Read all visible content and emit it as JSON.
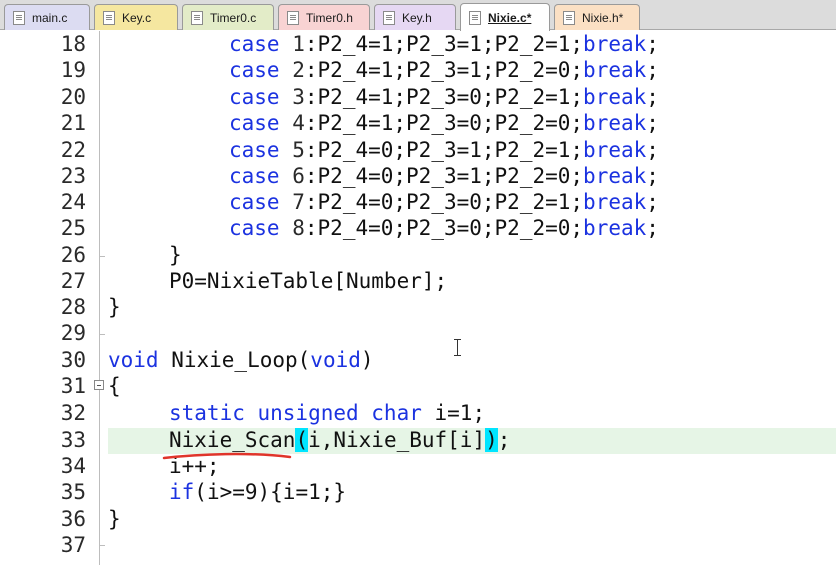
{
  "tabs": [
    {
      "label": "main.c",
      "color": "#dcdcf2"
    },
    {
      "label": "Key.c",
      "color": "#f5e7a0"
    },
    {
      "label": "Timer0.c",
      "color": "#e3ecc8"
    },
    {
      "label": "Timer0.h",
      "color": "#f8d3d3"
    },
    {
      "label": "Key.h",
      "color": "#e6d8f3"
    },
    {
      "label": "Nixie.c*",
      "color": "#ffffff",
      "active": true
    },
    {
      "label": "Nixie.h*",
      "color": "#fbe0c4"
    }
  ],
  "line_numbers": [
    "18",
    "19",
    "20",
    "21",
    "22",
    "23",
    "24",
    "25",
    "26",
    "27",
    "28",
    "29",
    "30",
    "31",
    "32",
    "33",
    "34",
    "35",
    "36",
    "37"
  ],
  "code": {
    "l18": {
      "kw": "case",
      "n": "1",
      "rest": ":P2_4=1;P2_3=1;P2_2=1;",
      "brk": "break",
      "end": ";"
    },
    "l19": {
      "kw": "case",
      "n": "2",
      "rest": ":P2_4=1;P2_3=1;P2_2=0;",
      "brk": "break",
      "end": ";"
    },
    "l20": {
      "kw": "case",
      "n": "3",
      "rest": ":P2_4=1;P2_3=0;P2_2=1;",
      "brk": "break",
      "end": ";"
    },
    "l21": {
      "kw": "case",
      "n": "4",
      "rest": ":P2_4=1;P2_3=0;P2_2=0;",
      "brk": "break",
      "end": ";"
    },
    "l22": {
      "kw": "case",
      "n": "5",
      "rest": ":P2_4=0;P2_3=1;P2_2=1;",
      "brk": "break",
      "end": ";"
    },
    "l23": {
      "kw": "case",
      "n": "6",
      "rest": ":P2_4=0;P2_3=1;P2_2=0;",
      "brk": "break",
      "end": ";"
    },
    "l24": {
      "kw": "case",
      "n": "7",
      "rest": ":P2_4=0;P2_3=0;P2_2=1;",
      "brk": "break",
      "end": ";"
    },
    "l25": {
      "kw": "case",
      "n": "8",
      "rest": ":P2_4=0;P2_3=0;P2_2=0;",
      "brk": "break",
      "end": ";"
    },
    "l26": "}",
    "l27": "P0=NixieTable[Number];",
    "l28": "}",
    "l30": {
      "kw": "void",
      "mid": " Nixie_Loop(",
      "kw2": "void",
      "end": ")"
    },
    "l31": "{",
    "l32": {
      "kw": "static unsigned char",
      "rest": " i=1;"
    },
    "l33": {
      "fn": "Nixie_Scan",
      "open": "(",
      "args": "i,Nixie_Buf[i]",
      "close": ")",
      "end": ";"
    },
    "l34": "i++;",
    "l35": {
      "kw": "if",
      "rest": "(i>=9){i=1;}"
    },
    "l36": "}"
  },
  "annotation_color": "#e0342a"
}
